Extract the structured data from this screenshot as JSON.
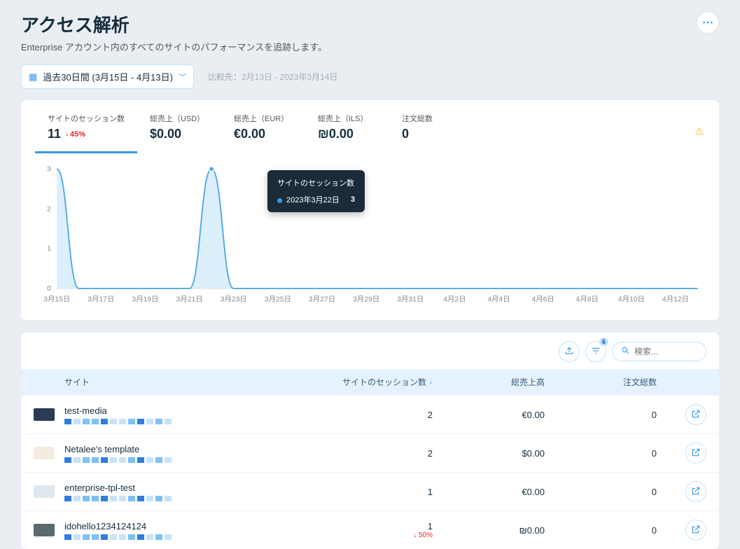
{
  "header": {
    "title": "アクセス解析",
    "subtitle": "Enterprise アカウント内のすべてのサイトのパフォーマンスを追跡します。"
  },
  "controls": {
    "date_range": "過去30日間 (3月15日 - 4月13日)",
    "compare": "比較先：2月13日 - 2023年3月14日"
  },
  "kpis": [
    {
      "label": "サイトのセッション数",
      "value": "11",
      "delta": "45%"
    },
    {
      "label": "総売上（USD）",
      "value": "$0.00"
    },
    {
      "label": "総売上（EUR）",
      "value": "€0.00"
    },
    {
      "label": "総売上（ILS）",
      "value": "₪0.00"
    },
    {
      "label": "注文総数",
      "value": "0"
    }
  ],
  "tooltip": {
    "title": "サイトのセッション数",
    "date": "2023年3月22日",
    "value": "3"
  },
  "chart_data": {
    "type": "area",
    "title": "",
    "xlabel": "",
    "ylabel": "",
    "ylim": [
      0,
      3
    ],
    "x_ticks": [
      "3月15日",
      "3月17日",
      "3月19日",
      "3月21日",
      "3月23日",
      "3月25日",
      "3月27日",
      "3月29日",
      "3月31日",
      "4月2日",
      "4月4日",
      "4月6日",
      "4月8日",
      "4月10日",
      "4月12日"
    ],
    "y_ticks": [
      0,
      1,
      2,
      3
    ],
    "categories": [
      "3月15日",
      "3月16日",
      "3月17日",
      "3月18日",
      "3月19日",
      "3月20日",
      "3月21日",
      "3月22日",
      "3月23日",
      "3月24日",
      "3月25日",
      "3月26日",
      "3月27日",
      "3月28日",
      "3月29日",
      "3月30日",
      "3月31日",
      "4月1日",
      "4月2日",
      "4月3日",
      "4月4日",
      "4月5日",
      "4月6日",
      "4月7日",
      "4月8日",
      "4月9日",
      "4月10日",
      "4月11日",
      "4月12日",
      "4月13日"
    ],
    "series": [
      {
        "name": "サイトのセッション数",
        "values": [
          3,
          0,
          0,
          0,
          0,
          0,
          0,
          3,
          0,
          0,
          0,
          0,
          0,
          0,
          0,
          0,
          0,
          0,
          0,
          0,
          0,
          0,
          0,
          0,
          0,
          0,
          0,
          0,
          0,
          0
        ]
      }
    ]
  },
  "table": {
    "filter_count": "6",
    "search_placeholder": "検索...",
    "columns": {
      "site": "サイト",
      "sessions": "サイトのセッション数",
      "revenue": "総売上高",
      "orders": "注文総数"
    },
    "rows": [
      {
        "name": "test-media",
        "sessions": "2",
        "revenue": "€0.00",
        "orders": "0"
      },
      {
        "name": "Netalee's template",
        "sessions": "2",
        "revenue": "$0.00",
        "orders": "0"
      },
      {
        "name": "enterprise-tpl-test",
        "sessions": "1",
        "revenue": "€0.00",
        "orders": "0"
      },
      {
        "name": "idohello1234124124",
        "sessions": "1",
        "delta": "50%",
        "revenue": "₪0.00",
        "orders": "0"
      }
    ]
  }
}
